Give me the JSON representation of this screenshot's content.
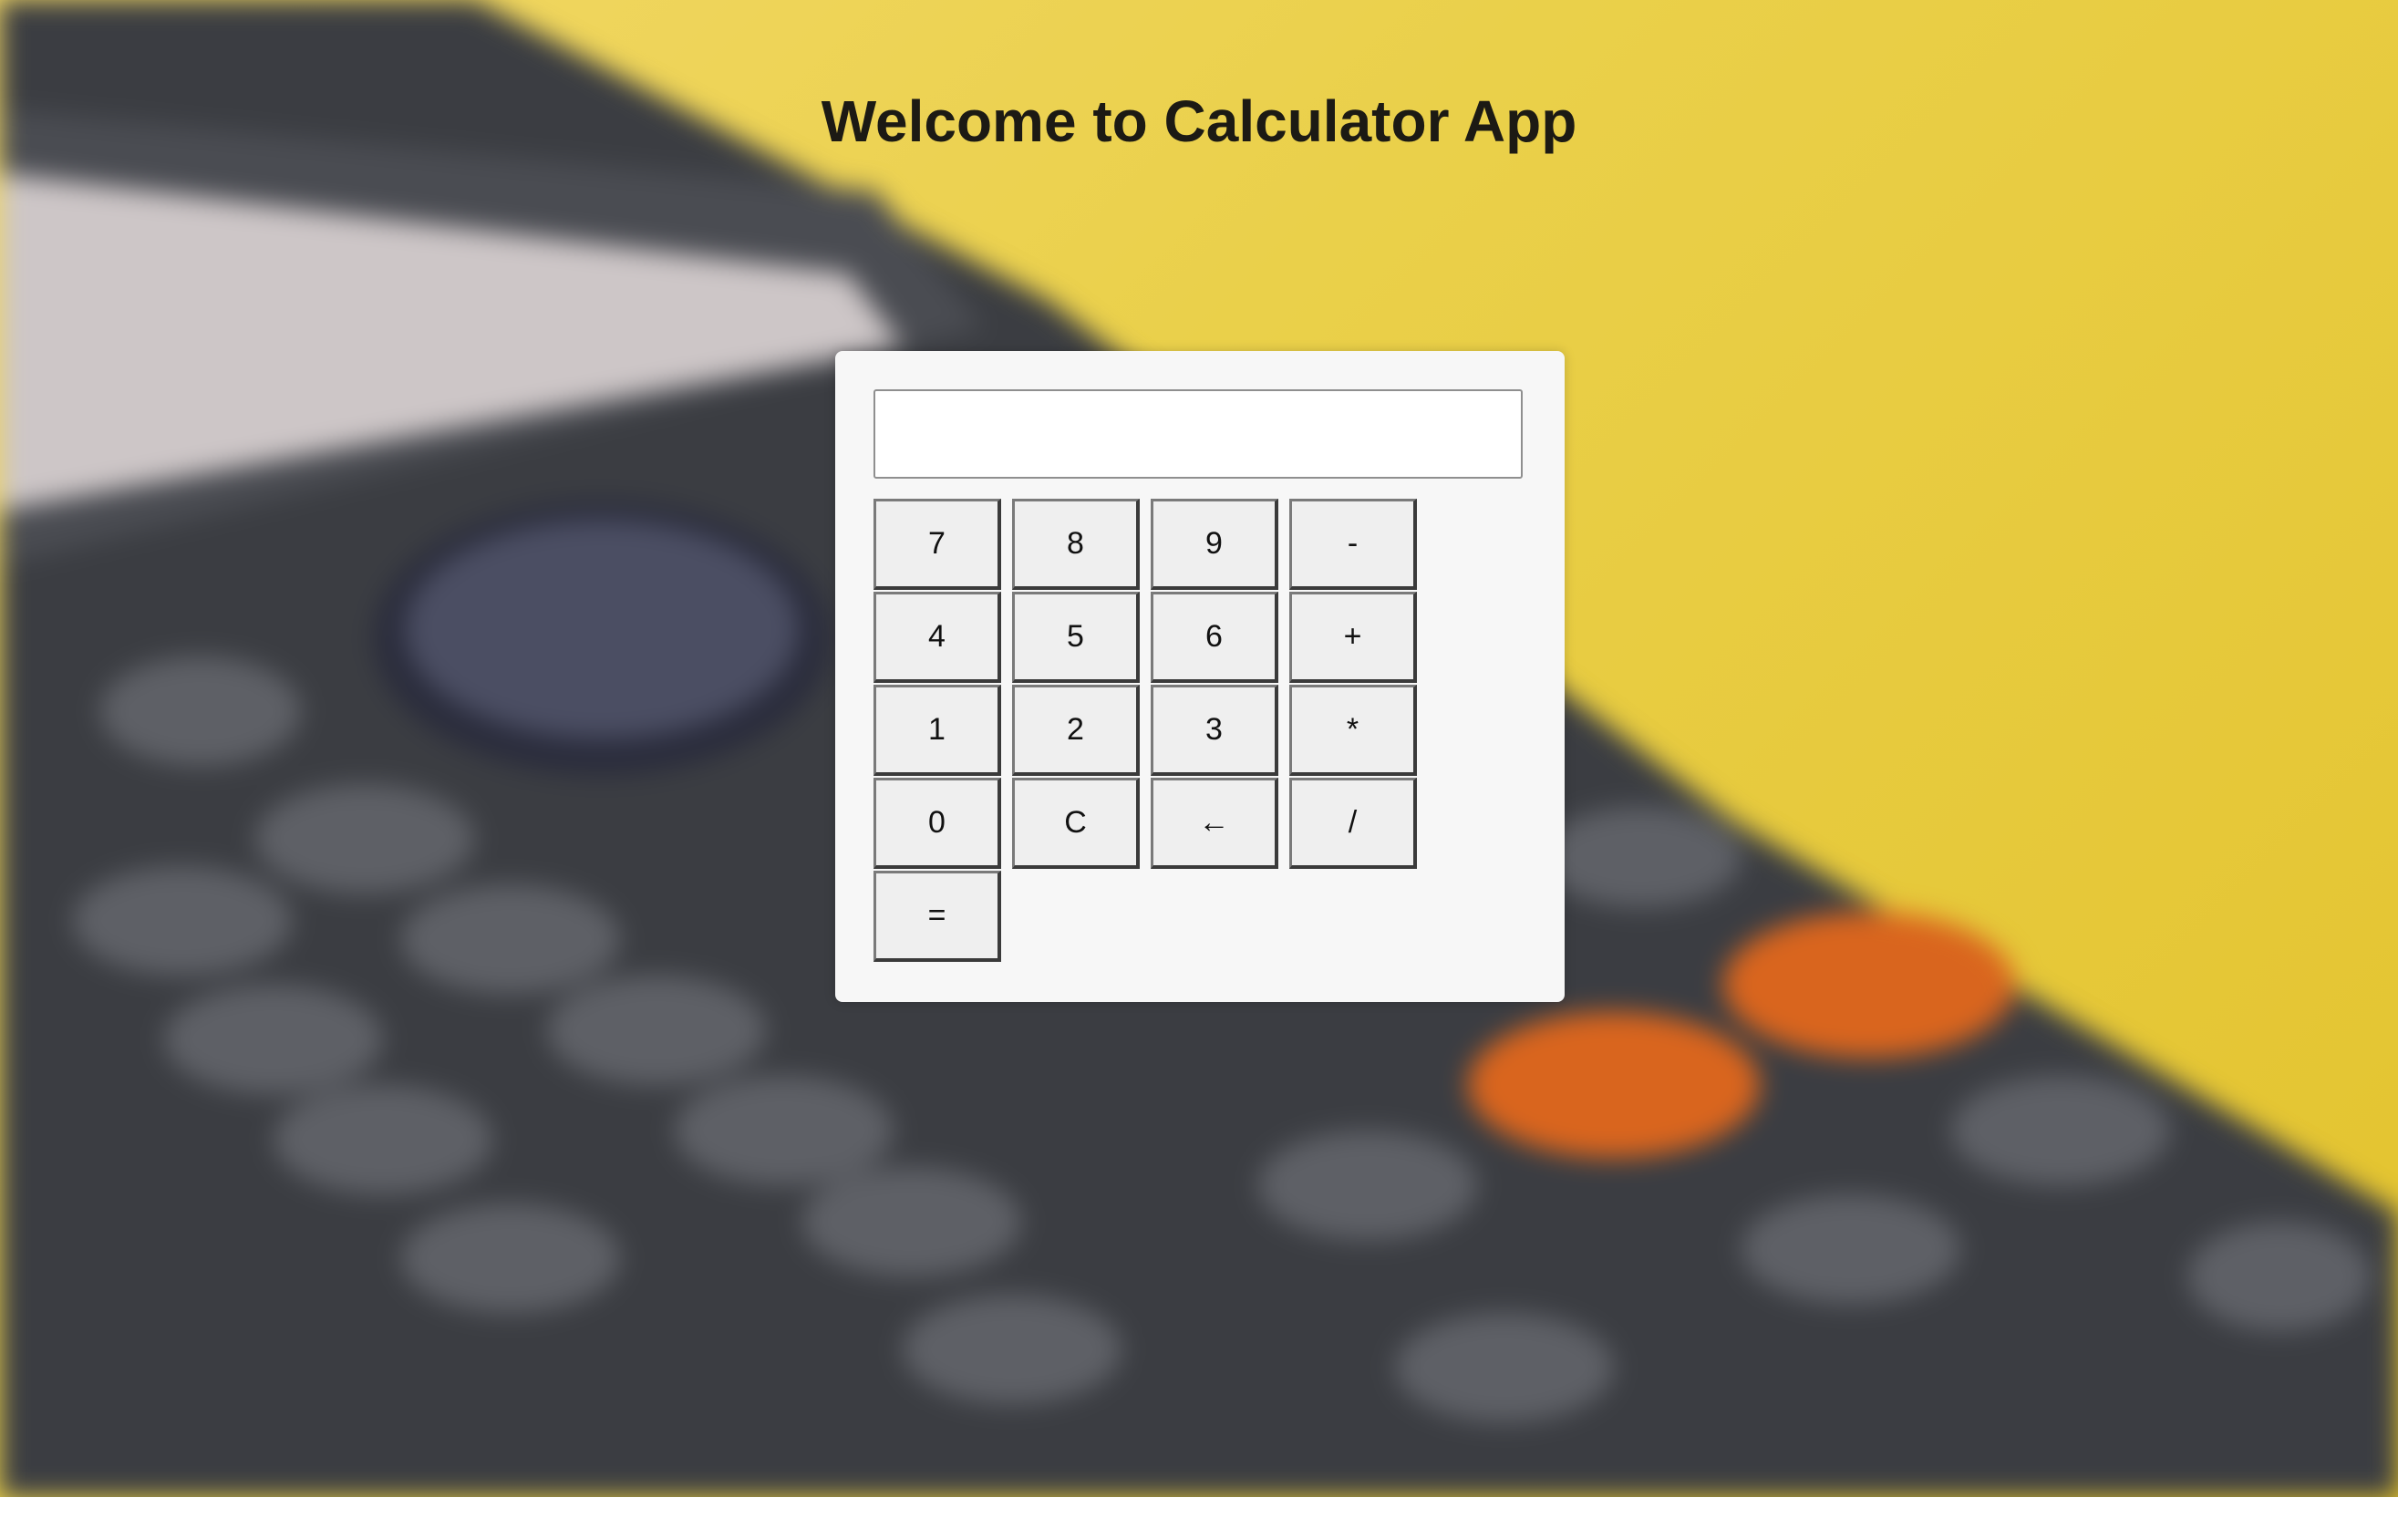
{
  "page": {
    "title": "Welcome to Calculator App"
  },
  "calculator": {
    "display_value": "",
    "keys": {
      "k7": "7",
      "k8": "8",
      "k9": "9",
      "minus": "-",
      "k4": "4",
      "k5": "5",
      "k6": "6",
      "plus": "+",
      "k1": "1",
      "k2": "2",
      "k3": "3",
      "multiply": "*",
      "k0": "0",
      "clear": "C",
      "backspace": "←",
      "divide": "/",
      "equals": "="
    }
  },
  "colors": {
    "background_yellow": "#e8c93a",
    "panel": "#f7f7f7",
    "key_face": "#efefef",
    "title_text": "#1c1a14"
  }
}
